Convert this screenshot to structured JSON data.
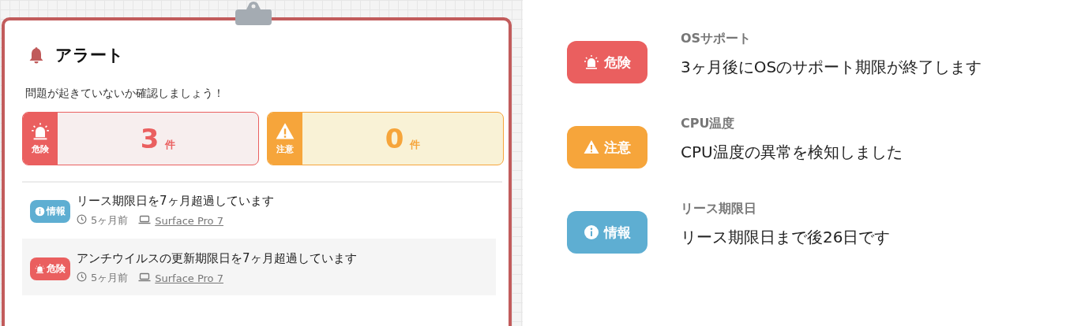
{
  "panel": {
    "title": "アラート",
    "subtitle": "問題が起きていないか確認しましょう！",
    "summary": [
      {
        "kind": "danger",
        "label": "危険",
        "count": "3",
        "unit": "件"
      },
      {
        "kind": "warning",
        "label": "注意",
        "count": "0",
        "unit": "件"
      }
    ],
    "alerts": [
      {
        "kind": "info",
        "badge": "情報",
        "message": "リース期限日を7ヶ月超過しています",
        "time": "5ヶ月前",
        "device": "Surface Pro 7",
        "selected": false
      },
      {
        "kind": "danger",
        "badge": "危険",
        "message": "アンチウイルスの更新期限日を7ヶ月超過しています",
        "time": "5ヶ月前",
        "device": "Surface Pro 7",
        "selected": true
      }
    ]
  },
  "examples": [
    {
      "kind": "danger",
      "badge": "危険",
      "title": "OSサポート",
      "message": "3ヶ月後にOSのサポート期限が終了します"
    },
    {
      "kind": "warning",
      "badge": "注意",
      "title": "CPU温度",
      "message": "CPU温度の異常を検知しました"
    },
    {
      "kind": "info",
      "badge": "情報",
      "title": "リース期限日",
      "message": "リース期限日まで後26日です"
    }
  ]
}
